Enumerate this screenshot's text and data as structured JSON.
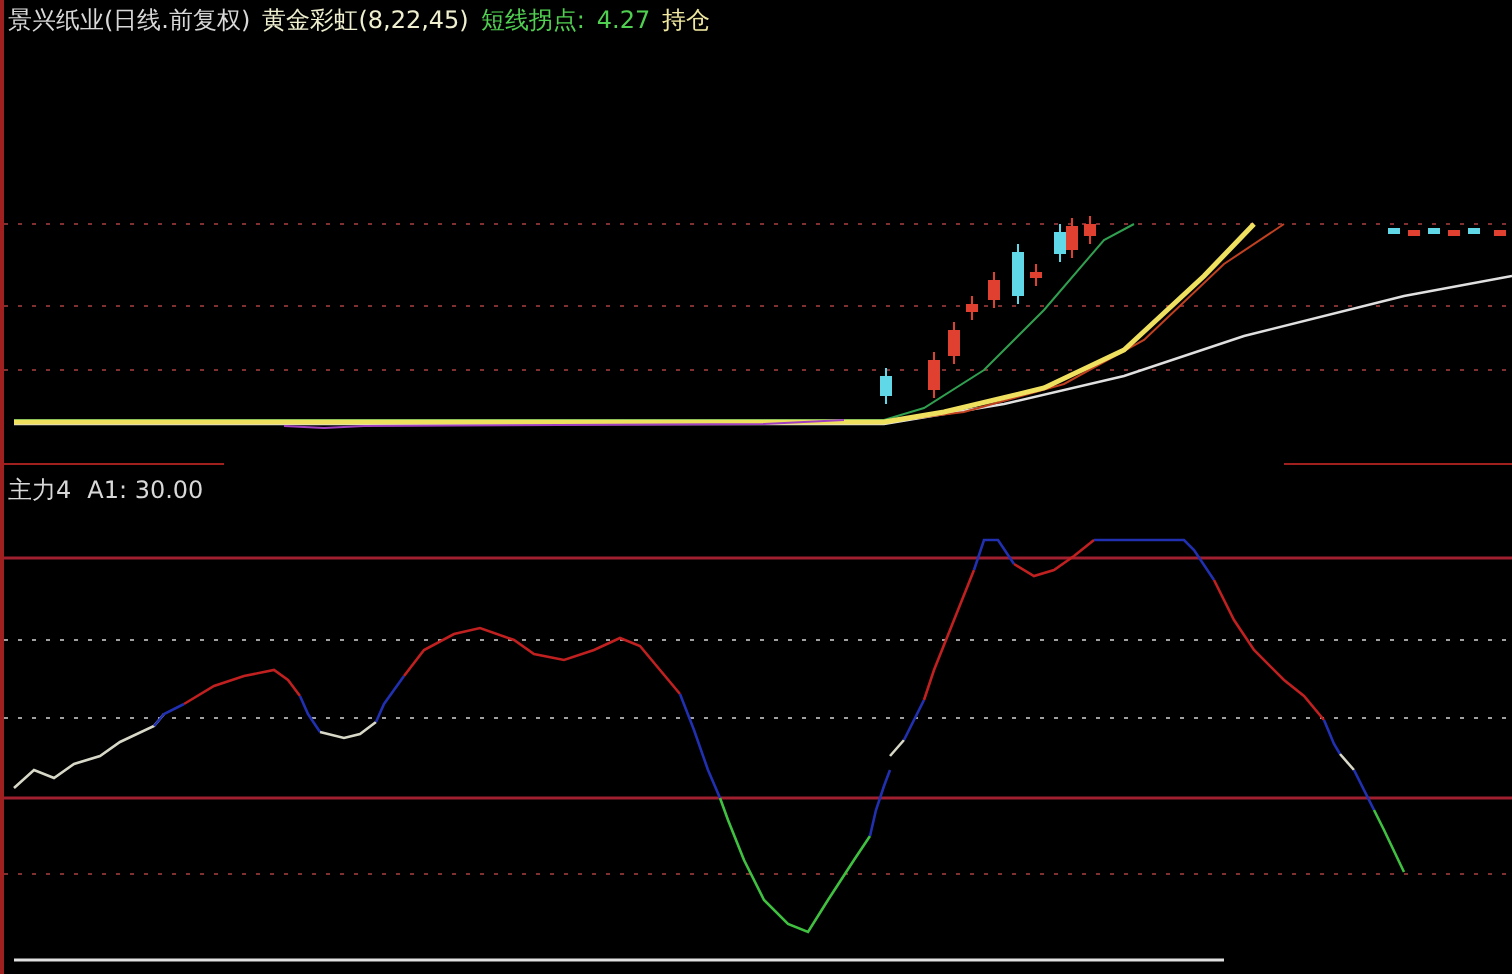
{
  "header": {
    "title": "景兴纸业(日线.前复权)",
    "indicator": "黄金彩虹(8,22,45)",
    "signal_label": "短线拐点:",
    "signal_value": "4.27",
    "extra": "持仓"
  },
  "lower_panel": {
    "title": "主力4",
    "reading": "A1: 30.00"
  }
}
